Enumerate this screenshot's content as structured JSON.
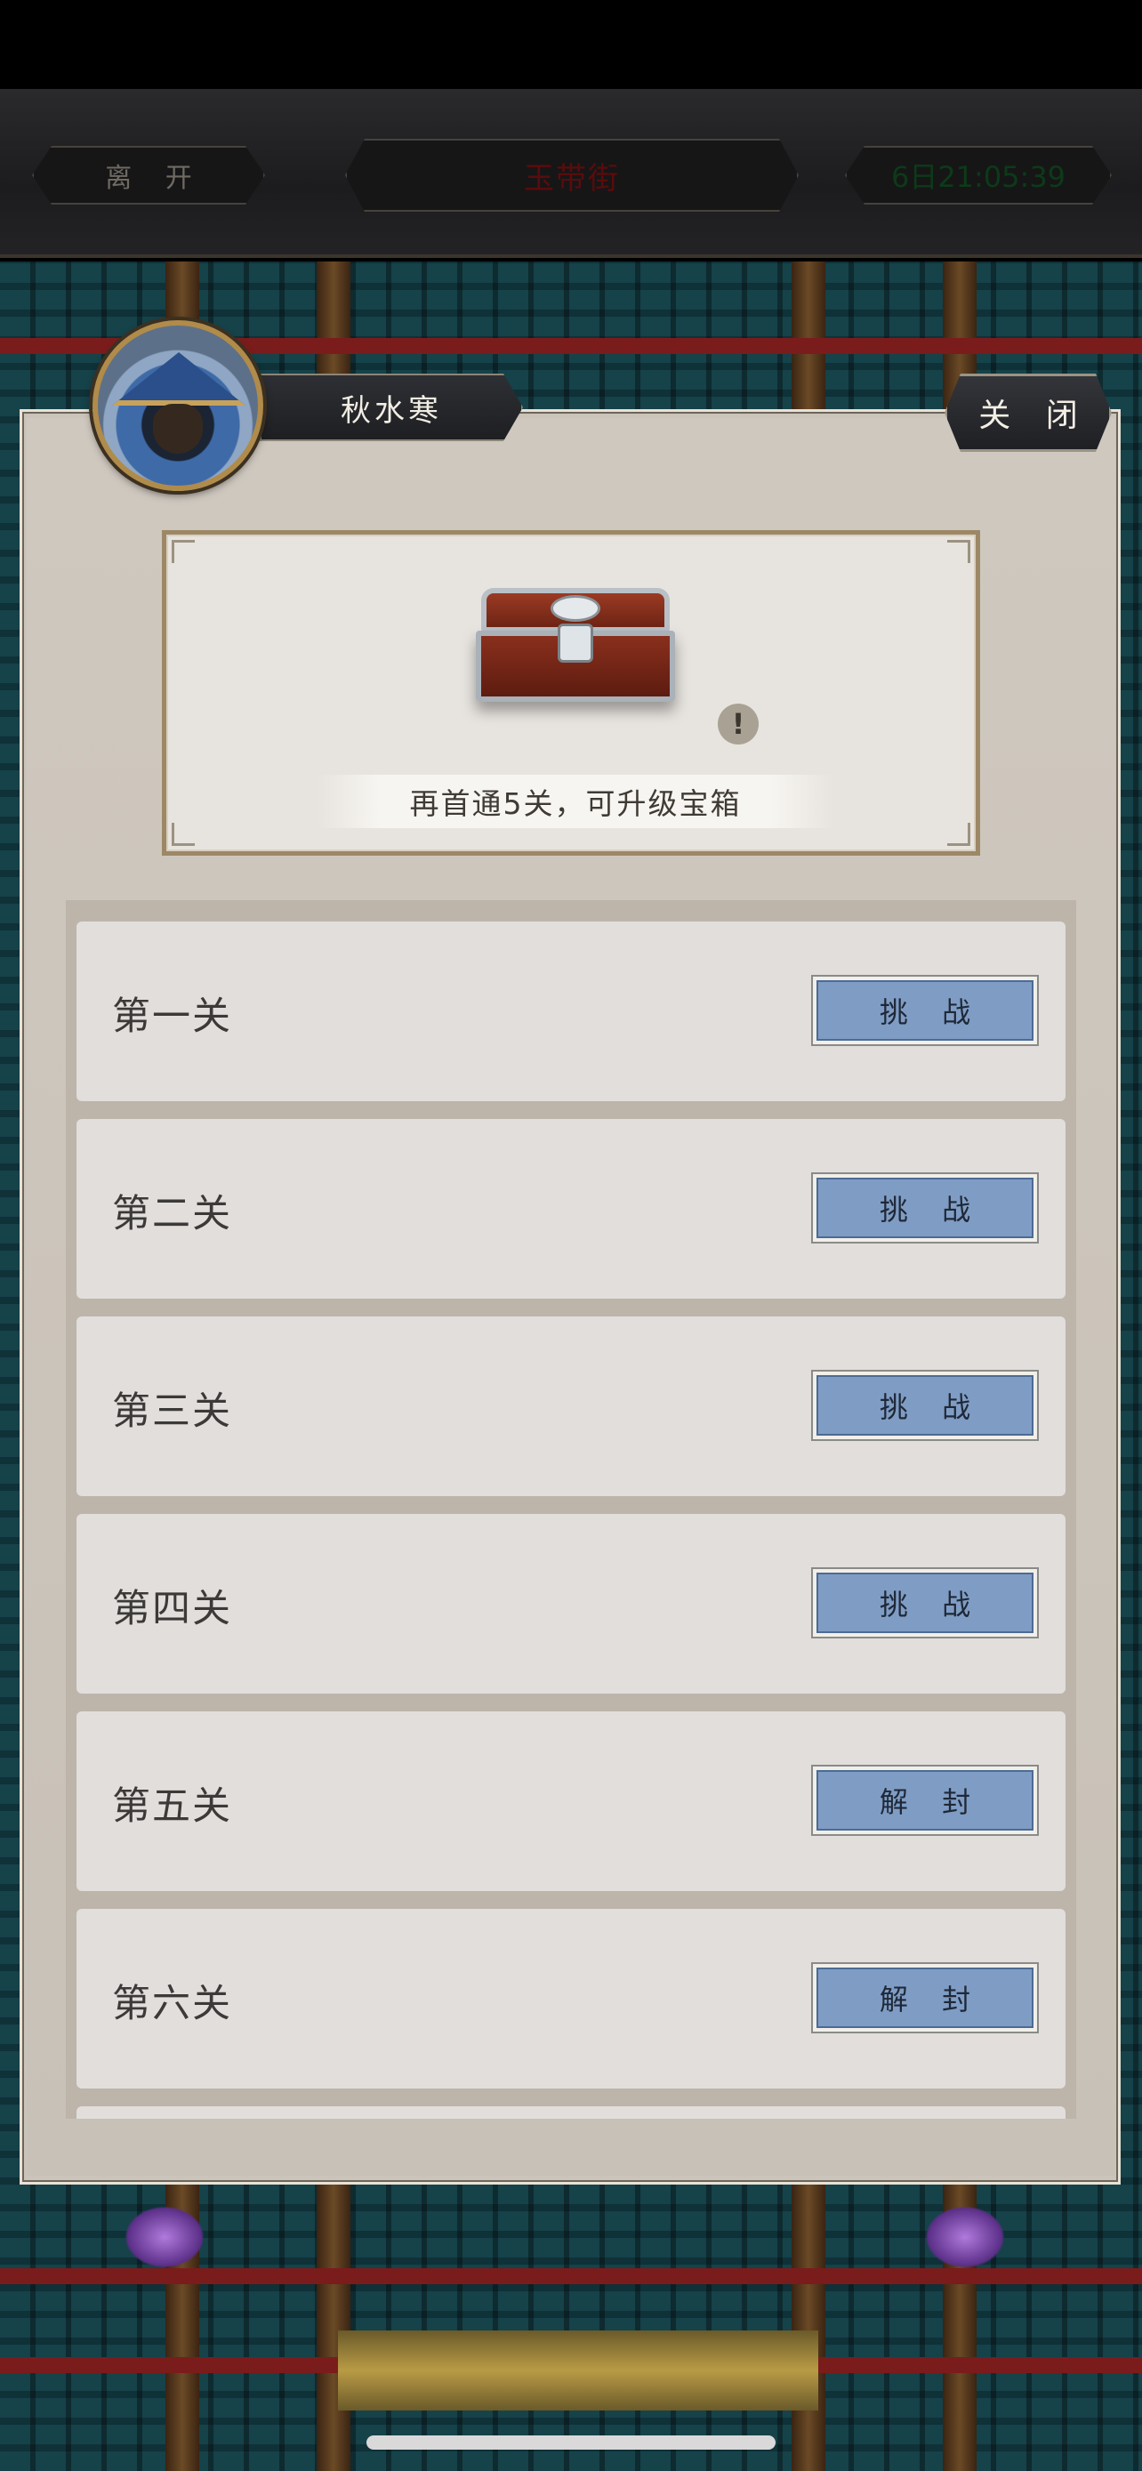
{
  "top_bar": {
    "leave_label": "离 开",
    "location": "玉带街",
    "clock": "6日21:05:39"
  },
  "panel": {
    "character_name": "秋水寒",
    "close_label": "关 闭",
    "chest_hint": "再首通5关，可升级宝箱",
    "info_icon": "!"
  },
  "stages": [
    {
      "label": "第一关",
      "button": "挑 战"
    },
    {
      "label": "第二关",
      "button": "挑 战"
    },
    {
      "label": "第三关",
      "button": "挑 战"
    },
    {
      "label": "第四关",
      "button": "挑 战"
    },
    {
      "label": "第五关",
      "button": "解 封"
    },
    {
      "label": "第六关",
      "button": "解 封"
    }
  ],
  "colors": {
    "location_text": "#5a0c0c",
    "clock_text": "#0d3a18",
    "stage_button": "#7f9dc4"
  },
  "icons": [
    "chest-icon",
    "info-icon",
    "character-avatar"
  ]
}
